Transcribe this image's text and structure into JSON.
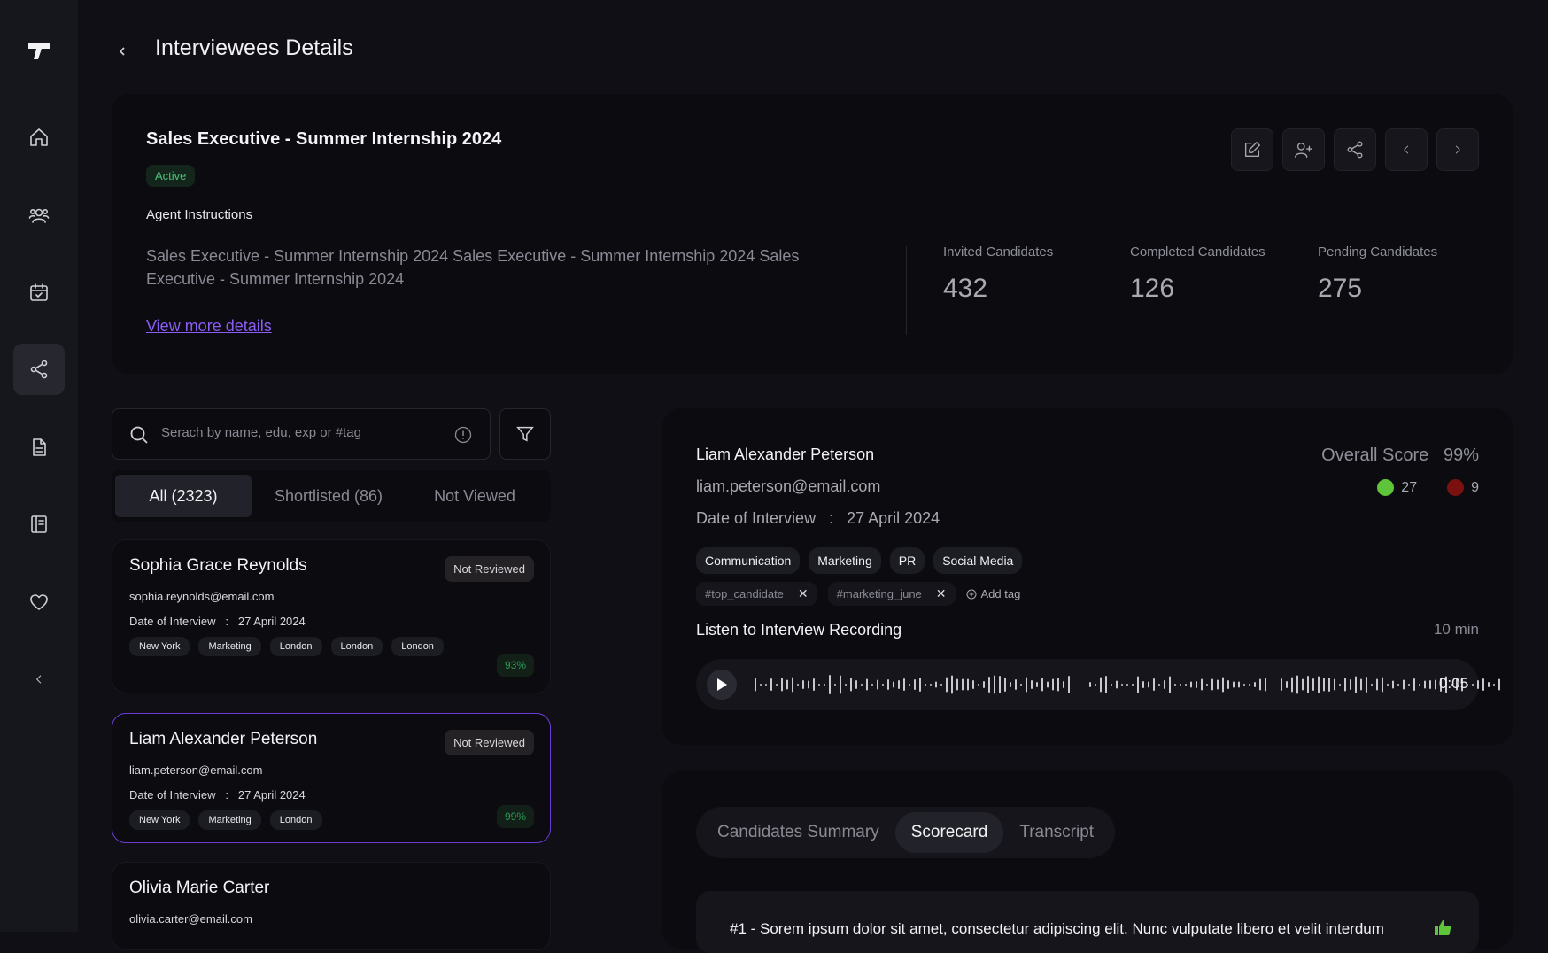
{
  "app": {
    "page_title": "Interviewees Details"
  },
  "sidebar": {
    "items": [
      {
        "icon": "home-icon"
      },
      {
        "icon": "users-icon"
      },
      {
        "icon": "calendar-check-icon"
      },
      {
        "icon": "share-icon",
        "active": true
      },
      {
        "icon": "document-icon"
      },
      {
        "icon": "book-icon"
      },
      {
        "icon": "heart-icon"
      },
      {
        "icon": "collapse-chevron-icon"
      }
    ]
  },
  "job": {
    "title": "Sales Executive - Summer Internship 2024",
    "status": "Active",
    "agent_label": "Agent Instructions",
    "agent_text": "Sales Executive - Summer Internship 2024 Sales Executive - Summer Internship 2024 Sales Executive - Summer Internship 2024",
    "view_more": "View more details",
    "stats": [
      {
        "label": "Invited Candidates",
        "value": "432"
      },
      {
        "label": "Completed Candidates",
        "value": "126"
      },
      {
        "label": "Pending Candidates",
        "value": "275"
      }
    ],
    "actions": [
      "edit-icon",
      "add-user-icon",
      "share-icon",
      "chevron-left-icon",
      "chevron-right-icon"
    ]
  },
  "search": {
    "placeholder": "Serach by name, edu, exp or #tag"
  },
  "list_tabs": [
    {
      "label": "All (2323)",
      "active": true
    },
    {
      "label": "Shortlisted (86)"
    },
    {
      "label": "Not Viewed"
    }
  ],
  "candidates": [
    {
      "name": "Sophia Grace Reynolds",
      "badge": "Not Reviewed",
      "email": "sophia.reynolds@email.com",
      "date_label": "Date of Interview",
      "date": "27 April 2024",
      "tags": [
        "New York",
        "Marketing",
        "London",
        "London",
        "London"
      ],
      "score": "93%"
    },
    {
      "name": "Liam Alexander Peterson",
      "badge": "Not Reviewed",
      "email": "liam.peterson@email.com",
      "date_label": "Date of Interview",
      "date": "27 April 2024",
      "tags": [
        "New York",
        "Marketing",
        "London"
      ],
      "score": "99%"
    },
    {
      "name": "Olivia Marie Carter",
      "email": "olivia.carter@email.com"
    }
  ],
  "detail": {
    "name": "Liam Alexander Peterson",
    "email": "liam.peterson@email.com",
    "date_label": "Date of Interview",
    "date": "27 April 2024",
    "overall_label": "Overall Score",
    "overall_value": "99%",
    "positive_count": "27",
    "negative_count": "9",
    "positive_color": "#5ec43a",
    "negative_color": "#7a1010",
    "skills": [
      "Communication",
      "Marketing",
      "PR",
      "Social Media"
    ],
    "hashtags": [
      "#top_candidate",
      "#marketing_june"
    ],
    "add_tag": "Add tag",
    "recording_title": "Listen to Interview Recording",
    "recording_duration": "10 min",
    "current_time": "0:05"
  },
  "scorecard": {
    "tabs": [
      {
        "label": "Candidates Summary"
      },
      {
        "label": "Scorecard",
        "active": true
      },
      {
        "label": "Transcript"
      }
    ],
    "question": "#1 - Sorem ipsum dolor sit amet, consectetur adipiscing elit. Nunc vulputate libero et velit interdum"
  }
}
